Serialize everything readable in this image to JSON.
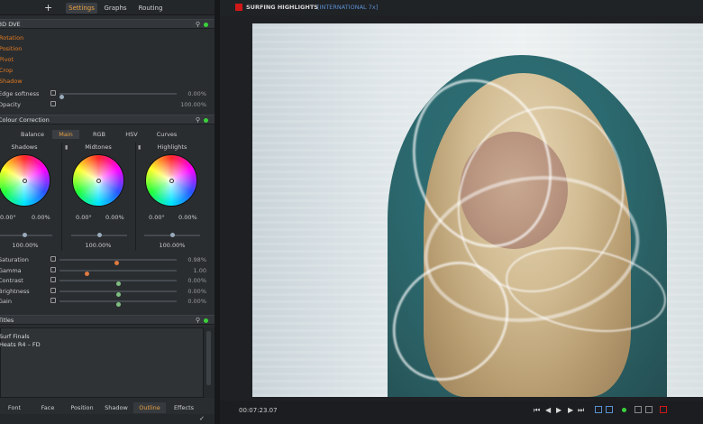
{
  "left_panel": {
    "top_tabs": [
      "Settings",
      "Graphs",
      "Routing"
    ],
    "add_icon": "+",
    "dve": {
      "title": "3D DVE",
      "items": [
        "Rotation",
        "Position",
        "Pivot",
        "Crop",
        "Shadow"
      ],
      "params": [
        {
          "label": "Edge softness",
          "value": "0.00%",
          "level": 0.0
        },
        {
          "label": "Opacity",
          "value": "100.00%",
          "level": 1.0
        }
      ]
    },
    "colour_correction": {
      "title": "Colour Correction",
      "tabs": [
        "Balance",
        "Main",
        "RGB",
        "HSV",
        "Curves"
      ],
      "active_tab": "Main",
      "wheels": [
        {
          "name": "Shadows",
          "val1": "0.00°",
          "val2": "0.00%",
          "pct": "100.00%"
        },
        {
          "name": "Midtones",
          "val1": "0.00°",
          "val2": "0.00%",
          "pct": "100.00%"
        },
        {
          "name": "Highlights",
          "val1": "0.00°",
          "val2": "0.00%",
          "pct": "100.00%"
        }
      ],
      "params": [
        {
          "label": "Saturation",
          "value": "0.98%",
          "level": 0.49,
          "color": "#e07a40"
        },
        {
          "label": "Gamma",
          "value": "1.00",
          "level": 0.22,
          "color": "#e07a40"
        },
        {
          "label": "Contrast",
          "value": "0.00%",
          "level": 0.5,
          "color": "#7fbf7f"
        },
        {
          "label": "Brightness",
          "value": "0.00%",
          "level": 0.5,
          "color": "#7fbf7f"
        },
        {
          "label": "Gain",
          "value": "0.00%",
          "level": 0.5,
          "color": "#7fbf7f"
        }
      ]
    },
    "titles": {
      "title": "Titles",
      "lines": [
        "Surf Finals",
        "Heats R4 – FD"
      ]
    },
    "bottom_tabs": [
      "Font",
      "Face",
      "Position",
      "Shadow",
      "Outline",
      "Effects"
    ],
    "active_bottom_tab": "Outline",
    "check_glyph": "✓"
  },
  "viewer": {
    "title": "SURFING HIGHLIGHTS",
    "subtitle": "[INTERNATIONAL 7x]",
    "timecode": "00:07:23.07",
    "transport": [
      "⏮",
      "◀",
      "▶",
      "▶",
      "⏭"
    ],
    "colors": {
      "record": "#d01818",
      "accent": "#e8a040"
    }
  }
}
